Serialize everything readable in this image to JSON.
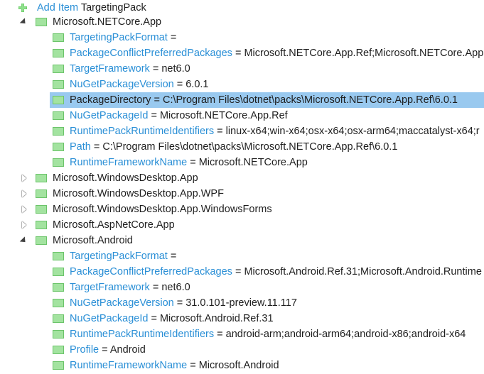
{
  "header": {
    "add_prefix": "Add Item",
    "add_name": "TargetingPack"
  },
  "colors": {
    "metadata_name": "#2a8fd6",
    "selection": "#99c9ef",
    "item_icon": "#a3e3a0",
    "add_icon": "#5cc45a"
  },
  "groups": [
    {
      "name": "Microsoft.NETCore.App",
      "expanded": true,
      "metadata": [
        {
          "key": "TargetingPackFormat",
          "value": ""
        },
        {
          "key": "PackageConflictPreferredPackages",
          "value": "Microsoft.NETCore.App.Ref;Microsoft.NETCore.App."
        },
        {
          "key": "TargetFramework",
          "value": "net6.0"
        },
        {
          "key": "NuGetPackageVersion",
          "value": "6.0.1"
        },
        {
          "key": "PackageDirectory",
          "value": "C:\\Program Files\\dotnet\\packs\\Microsoft.NETCore.App.Ref\\6.0.1",
          "selected": true
        },
        {
          "key": "NuGetPackageId",
          "value": "Microsoft.NETCore.App.Ref"
        },
        {
          "key": "RuntimePackRuntimeIdentifiers",
          "value": "linux-x64;win-x64;osx-x64;osx-arm64;maccatalyst-x64;r"
        },
        {
          "key": "Path",
          "value": "C:\\Program Files\\dotnet\\packs\\Microsoft.NETCore.App.Ref\\6.0.1"
        },
        {
          "key": "RuntimeFrameworkName",
          "value": "Microsoft.NETCore.App"
        }
      ]
    },
    {
      "name": "Microsoft.WindowsDesktop.App",
      "expanded": false
    },
    {
      "name": "Microsoft.WindowsDesktop.App.WPF",
      "expanded": false
    },
    {
      "name": "Microsoft.WindowsDesktop.App.WindowsForms",
      "expanded": false
    },
    {
      "name": "Microsoft.AspNetCore.App",
      "expanded": false
    },
    {
      "name": "Microsoft.Android",
      "expanded": true,
      "metadata": [
        {
          "key": "TargetingPackFormat",
          "value": ""
        },
        {
          "key": "PackageConflictPreferredPackages",
          "value": "Microsoft.Android.Ref.31;Microsoft.Android.Runtime"
        },
        {
          "key": "TargetFramework",
          "value": "net6.0"
        },
        {
          "key": "NuGetPackageVersion",
          "value": "31.0.101-preview.11.117"
        },
        {
          "key": "NuGetPackageId",
          "value": "Microsoft.Android.Ref.31"
        },
        {
          "key": "RuntimePackRuntimeIdentifiers",
          "value": "android-arm;android-arm64;android-x86;android-x64"
        },
        {
          "key": "Profile",
          "value": "Android"
        },
        {
          "key": "RuntimeFrameworkName",
          "value": "Microsoft.Android"
        }
      ]
    }
  ]
}
